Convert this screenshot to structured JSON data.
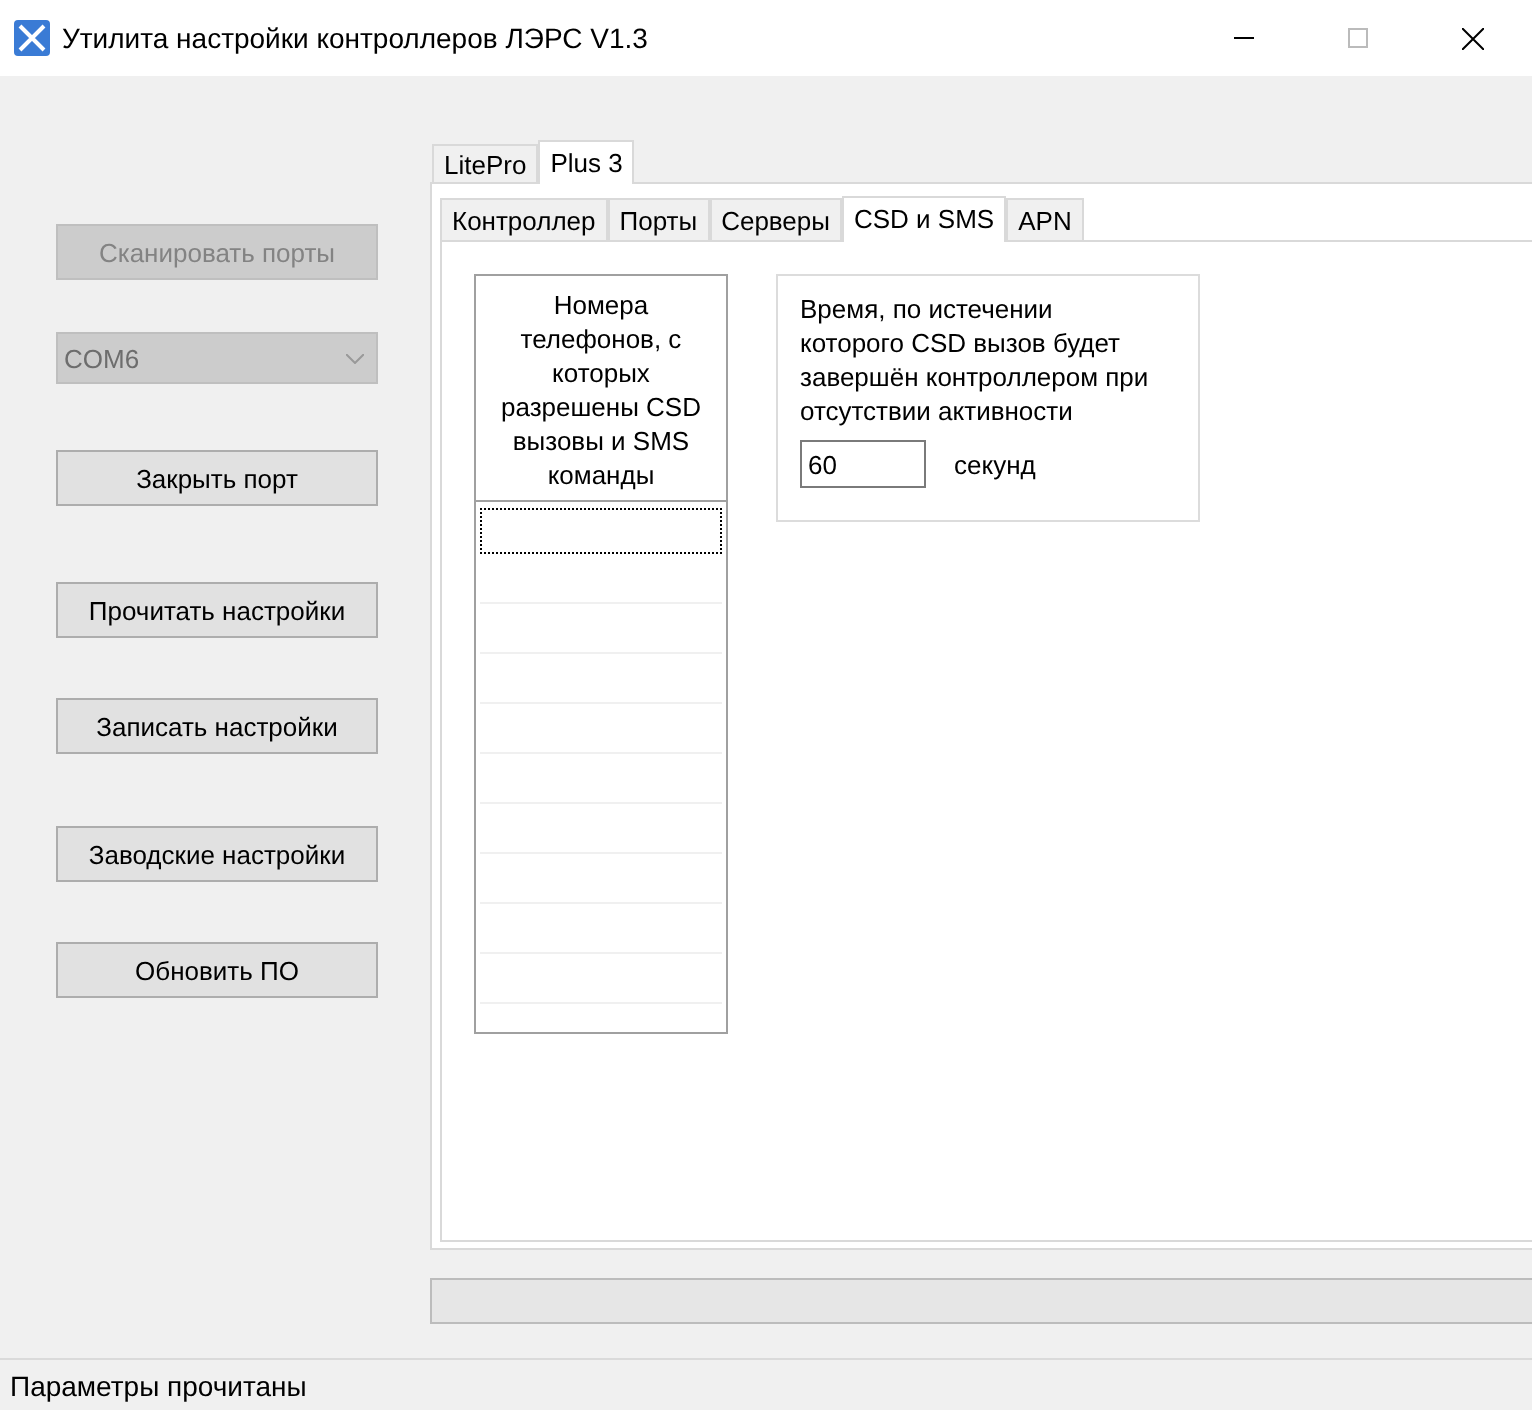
{
  "window": {
    "title": "Утилита настройки контроллеров ЛЭРС V1.3"
  },
  "sidebar": {
    "buttons": [
      {
        "label": "Сканировать порты",
        "disabled": true,
        "kind": "button"
      },
      {
        "label": "COM6",
        "disabled": true,
        "kind": "combo"
      },
      {
        "label": "Закрыть порт",
        "disabled": false,
        "kind": "button"
      },
      {
        "label": "Прочитать настройки",
        "disabled": false,
        "kind": "button"
      },
      {
        "label": "Записать настройки",
        "disabled": false,
        "kind": "button"
      },
      {
        "label": "Заводские настройки",
        "disabled": false,
        "kind": "button"
      },
      {
        "label": "Обновить ПО",
        "disabled": false,
        "kind": "button"
      }
    ]
  },
  "device_tabs": [
    {
      "label": "LitePro",
      "selected": false
    },
    {
      "label": "Plus 3",
      "selected": true
    }
  ],
  "settings_tabs": [
    {
      "label": "Контроллер",
      "selected": false
    },
    {
      "label": "Порты",
      "selected": false
    },
    {
      "label": "Серверы",
      "selected": false
    },
    {
      "label": "CSD и SMS",
      "selected": true
    },
    {
      "label": "APN",
      "selected": false
    }
  ],
  "phones_table": {
    "header": "Номера телефонов, с которых разрешены CSD вызовы и SMS команды",
    "rows": [
      {
        "selected": true
      },
      {
        "selected": false
      },
      {
        "selected": false
      },
      {
        "selected": false
      },
      {
        "selected": false
      },
      {
        "selected": false
      },
      {
        "selected": false
      },
      {
        "selected": false
      },
      {
        "selected": false
      },
      {
        "selected": false
      }
    ]
  },
  "timeout_group": {
    "description": "Время, по истечении которого CSD вызов будет завершён контроллером при отсутствии активности",
    "value": "60",
    "unit": "секунд"
  },
  "progress": {
    "level": 0
  },
  "status_bar": "Параметры прочитаны"
}
